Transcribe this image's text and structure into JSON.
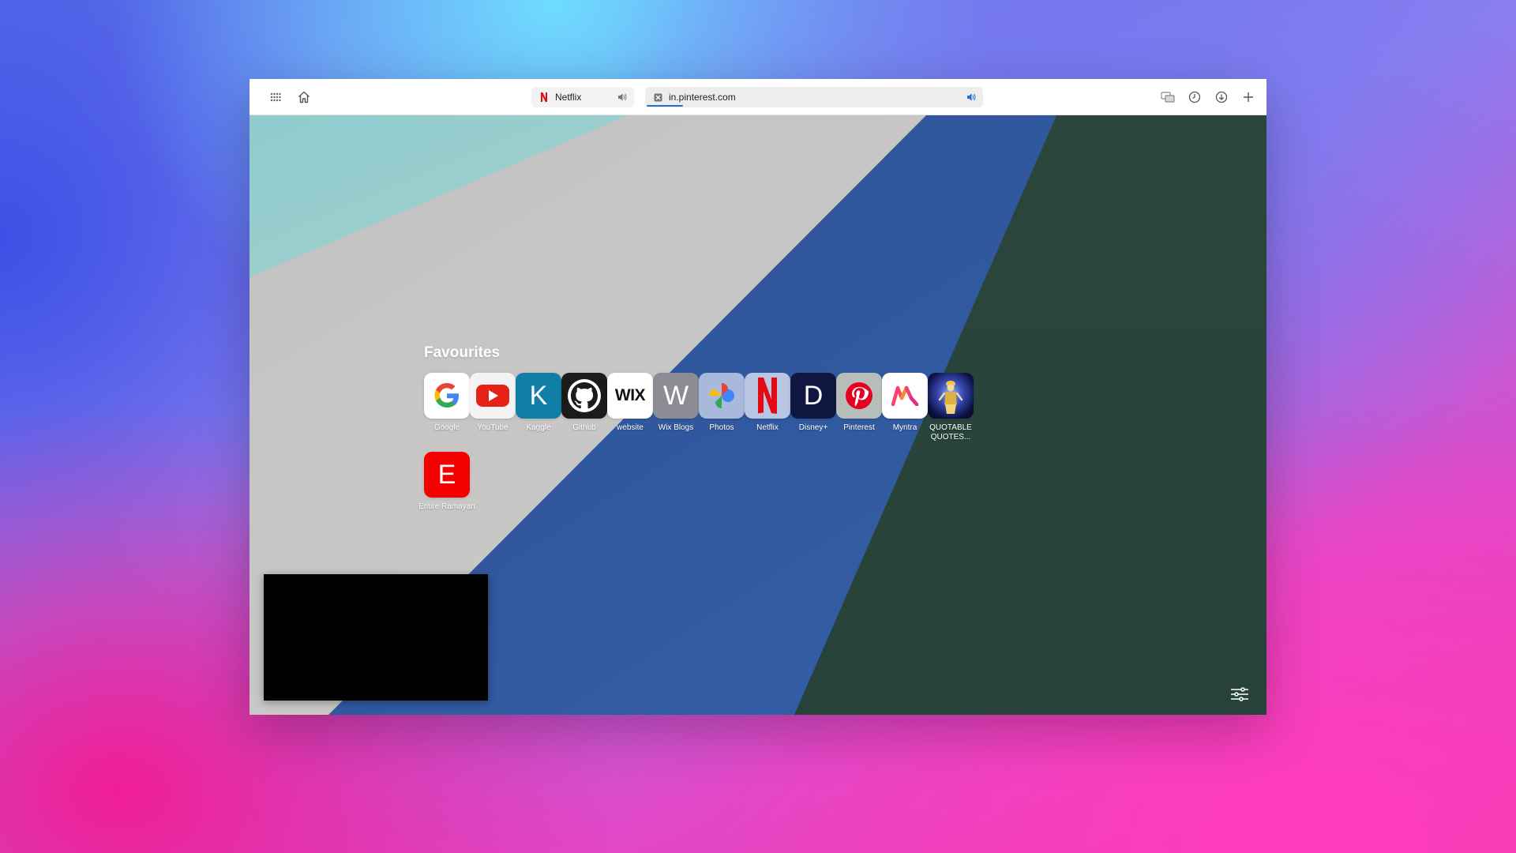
{
  "browser": {
    "tabs": [
      {
        "title": "Netflix",
        "favicon": "netflix-n-icon",
        "audio": "speaker-icon"
      },
      {
        "title": "in.pinterest.com",
        "favicon": "close-box-icon",
        "audio": "speaker-icon",
        "active": true
      }
    ],
    "toolbar_icons": [
      "grid-apps-icon",
      "home-icon",
      "tab-switch-icon",
      "history-icon",
      "download-icon",
      "plus-icon"
    ]
  },
  "speed_dial": {
    "heading": "Favourites",
    "tiles": [
      {
        "label": "Google",
        "icon": "google-icon"
      },
      {
        "label": "YouTube",
        "icon": "youtube-icon"
      },
      {
        "label": "Kaggle",
        "icon": "K"
      },
      {
        "label": "Github",
        "icon": "github-icon"
      },
      {
        "label": "website",
        "icon": "WIX"
      },
      {
        "label": "Wix Blogs",
        "icon": "W"
      },
      {
        "label": "Photos",
        "icon": "photos-pinwheel-icon"
      },
      {
        "label": "Netflix",
        "icon": "N"
      },
      {
        "label": "Disney+",
        "icon": "D"
      },
      {
        "label": "Pinterest",
        "icon": "pinterest-icon"
      },
      {
        "label": "Myntra",
        "icon": "myntra-icon"
      },
      {
        "label": "QUOTABLE QUOTES...",
        "icon": "thumbnail-image"
      },
      {
        "label": "Entire Ramayan",
        "icon": "E"
      }
    ]
  },
  "colors": {
    "kaggle": "#0f7fa8",
    "github": "#1b1b1b",
    "wix_blogs": "#8c8c94",
    "netflix": "#e50914",
    "disney": "#0f1740",
    "pinterest": "#e60023",
    "entire_ramayan": "#f50000",
    "teal": "#8ecbcc",
    "gray": "#c9c7c6",
    "blue": "#30589c",
    "dark_green": "#27443b"
  }
}
